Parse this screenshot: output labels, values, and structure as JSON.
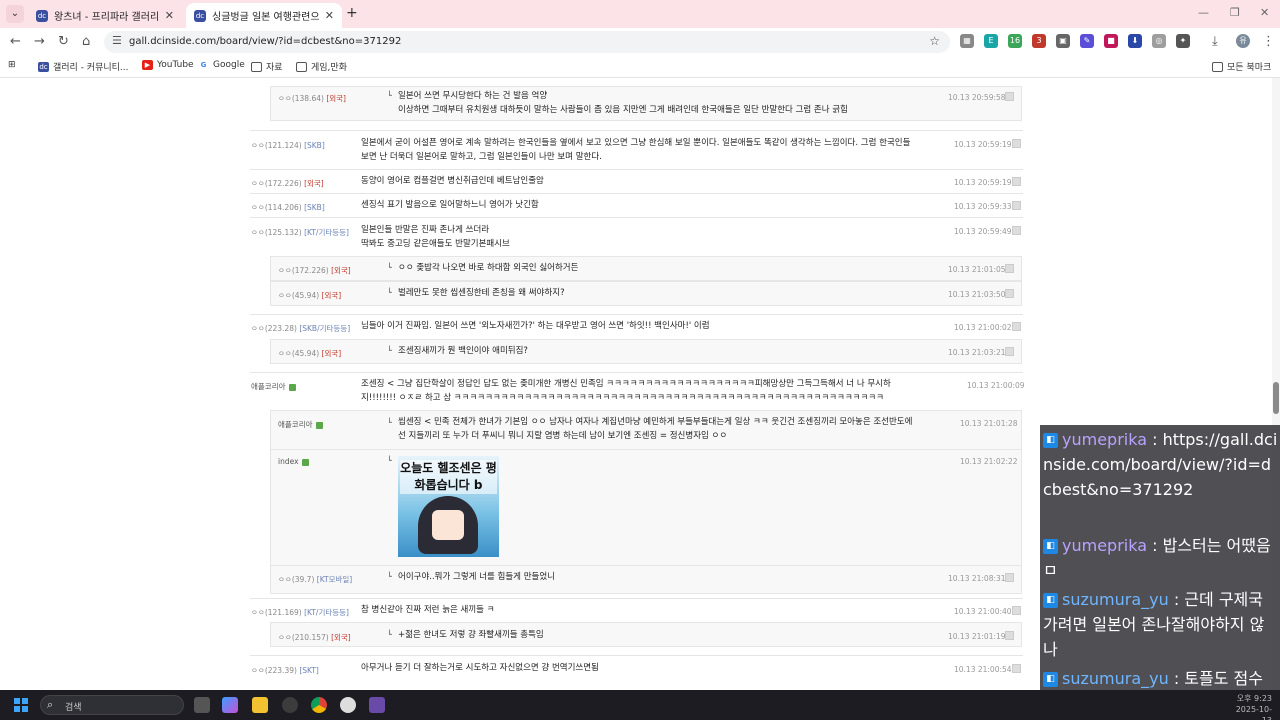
{
  "browser": {
    "tabs": [
      {
        "title": "왕츠녀 - 프리파라 갤러리",
        "active": false
      },
      {
        "title": "싱글벙글 일본 여행관련으로 조",
        "active": true
      }
    ],
    "url": "gall.dcinside.com/board/view/?id=dcbest&no=371292",
    "bookmarks": [
      "갤러리 - 커뮤니티...",
      "YouTube",
      "Google",
      "자료",
      "게임,만화"
    ],
    "all_bookmarks": "모든 북마크",
    "ext_badges": [
      "16",
      "3"
    ]
  },
  "comments": [
    {
      "nick": "ㅇㅇ",
      "ip": "(138.64)",
      "isp": "[외국]",
      "text": "일본어 쓰면 무시당한다 하는 건 발음 억양",
      "text2": "이상하면 그때부터 유치원생 대하듯이 말하는 사람들이 좀 있음 지만엔 그게 배려인데 한국애들은 일단 반말한다 그럼 존나 긁힘",
      "date": "10.13 20:59:58"
    },
    {
      "nick": "ㅇㅇ",
      "ip": "(121.124)",
      "isp": "[SKB]",
      "text": "일본에서 굳이 어설픈 영어로 계속 말하려는 한국인들을 옆에서 보고 있으면 그냥 한심해 보일 뿐이다. 일본애들도 똑같이 생각하는 느낌이다. 그럼 한국인들 보면 난 더욱더 일본어로 말하고, 그럼 일본인들이 나만 보며 말한다.",
      "date": "10.13 20:59:19"
    },
    {
      "nick": "ㅇㅇ",
      "ip": "(172.226)",
      "isp": "[외국]",
      "text": "동양이 영어로 컴플걸면 병신취급인데 베트남인줄암",
      "date": "10.13 20:59:19"
    },
    {
      "nick": "ㅇㅇ",
      "ip": "(114.206)",
      "isp": "[SKB]",
      "text": "센징식 표기 발음으로 일어말하느니 영어가 낫긴함",
      "date": "10.13 20:59:33"
    },
    {
      "nick": "ㅇㅇ",
      "ip": "(125.132)",
      "isp": "[KT/기타등등]",
      "text": "일본인들 반말은 진짜 존나게 쓰더라",
      "text2": "딱봐도 중고딩 같은애들도 반말기본패시브",
      "date": "10.13 20:59:49"
    },
    {
      "nick": "ㅇㅇ",
      "ip": "(172.226)",
      "isp": "[외국]",
      "text": "ㅇㅇ 좆밥각 나오면 바로 하대함 외국인 싫어하거든",
      "date": "10.13 21:01:05"
    },
    {
      "nick": "ㅇㅇ",
      "ip": "(45.94)",
      "isp": "[외국]",
      "text": "벌레만도 못한 씹센징한테 존칭을 왜 써야하지?",
      "date": "10.13 21:03:50"
    },
    {
      "nick": "ㅇㅇ",
      "ip": "(223.28)",
      "isp": "[SKB/기타등등]",
      "text": "님들아 이거 진짜임. 일본어 쓰면 '외노자새낀가?' 하는 대우받고 영어 쓰면 '하잇!! 백인사마!' 이럼",
      "date": "10.13 21:00:02"
    },
    {
      "nick": "ㅇㅇ",
      "ip": "(45.94)",
      "isp": "[외국]",
      "text": "조센징새끼가 뭔 백인이야 애미뒤짐?",
      "date": "10.13 21:03:21"
    },
    {
      "nick": "애플코리아",
      "text": "조센징 < 그냥 집단학살이 정답인 답도 없는 좆미개한 개병신 민족임 ㅋㅋㅋㅋㅋㅋㅋㅋㅋㅋㅋㅋㅋㅋㅋㅋㅋㅋㅋ피해망상만 그득그득해서 너 나 무시하지!!!!!!!! ㅇㅈㄹ 하고 삼 ㅋㅋㅋㅋㅋㅋㅋㅋㅋㅋㅋㅋㅋㅋㅋㅋㅋㅋㅋㅋㅋㅋㅋㅋㅋㅋㅋㅋㅋㅋㅋㅋㅋㅋㅋㅋㅋㅋㅋㅋㅋㅋㅋㅋㅋㅋㅋㅋㅋㅋㅋㅋㅋㅋㅋ",
      "date": "10.13 21:00:09"
    },
    {
      "nick": "애플코리아",
      "text": "씹센징 < 민족 전체가 한녀가 기본임 ㅇㅇ 남자나 여자나 계집년마냥 예민하게 부들부들대는게 일상 ㅋㅋ 웃긴건 조센징끼리 모아놓은 조선반도에선 지들끼리 또 누가 더 푸씨니 뭐니 지랄 염병 하는데 남이 보기엔 조센징 = 정신병자임 ㅇㅇ",
      "date": "10.13 21:01:28"
    },
    {
      "nick": "index",
      "sticker_text": "오늘도 헬조센은 평화롭습니다 b",
      "date": "10.13 21:02:22"
    },
    {
      "nick": "ㅇㅇ",
      "ip": "(39.7)",
      "isp": "[KT모바일]",
      "text": "어이구야..뭐가 그렇게 너를 힘들게 만들었니",
      "date": "10.13 21:08:31"
    },
    {
      "nick": "ㅇㅇ",
      "ip": "(121.169)",
      "isp": "[KT/기타등등]",
      "text": "참 병신같아 진짜 저런 늙은 새끼들 ㅋ",
      "date": "10.13 21:00:40"
    },
    {
      "nick": "ㅇㅇ",
      "ip": "(210.157)",
      "isp": "[외국]",
      "text": "+젊은 한녀도 저렇 걍 좌빨새끼들 총특임",
      "date": "10.13 21:01:19"
    },
    {
      "nick": "ㅇㅇ",
      "ip": "(223.39)",
      "isp": "[SKT]",
      "text": "아무거나 듣기 더 잘하는거로 시도하고 자신없으면 걍 번역기쓰면됨",
      "date": "10.13 21:00:54"
    }
  ],
  "chat": [
    {
      "user": "yumeprika",
      "text": "https://gall.dcinside.com/board/view/?id=dcbest&no=371292"
    },
    {
      "user": "yumeprika",
      "text": "밥스터는 어땠음ㅁ"
    },
    {
      "user": "suzumura_yu",
      "text": "근데 구제국 가려면 일본어 존나잘해야하지 않나"
    },
    {
      "user": "suzumura_yu",
      "text": "토플도 점수 많이 높아야하는데"
    }
  ],
  "taskbar": {
    "search_placeholder": "검색",
    "time": "오후 9:23",
    "date": "2025-10-13"
  }
}
